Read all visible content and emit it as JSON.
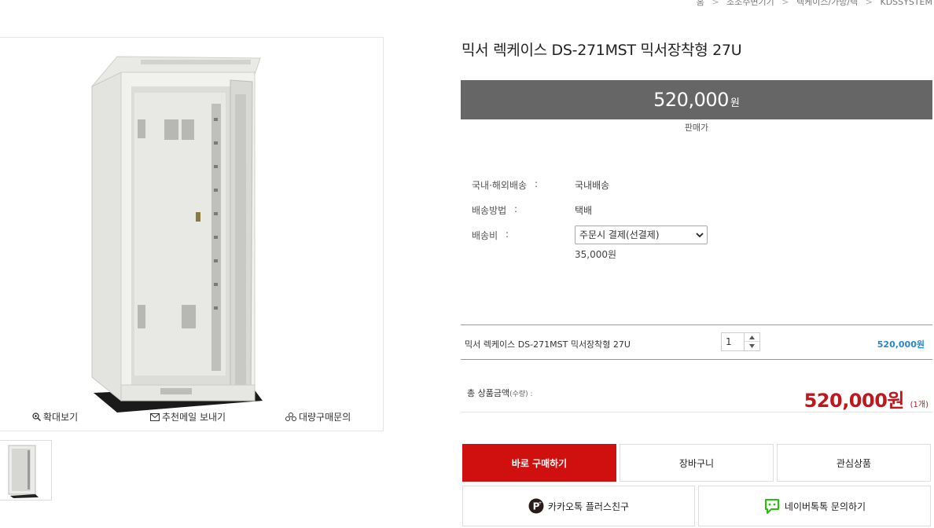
{
  "breadcrumb": {
    "home": "홈",
    "cat1": "조조주변기기",
    "cat2": "렉케이스/가방/렉",
    "cat3": "KDSSYSTEM",
    "sep": ">"
  },
  "product": {
    "title": "믹서 렉케이스 DS-271MST 믹서장착형 27U",
    "price_value": "520,000",
    "price_unit": "원",
    "price_caption": "판매가"
  },
  "image_actions": {
    "zoom": "확대보기",
    "email": "추천메일 보내기",
    "bulk": "대량구매문의"
  },
  "shipping": {
    "scope_label": "국내·해외배송",
    "scope_value": "국내배송",
    "method_label": "배송방법",
    "method_value": "택배",
    "fee_label": "배송비",
    "fee_select": "주문시 결제(선결제)",
    "fee_amount": "35,000원",
    "colon": ":"
  },
  "option": {
    "name": "믹서 렉케이스 DS-271MST 믹서장착형 27U",
    "qty": "1",
    "price": "520,000원"
  },
  "total": {
    "label": "총 상품금액",
    "label_sub": "(수량) :",
    "amount": "520,000원",
    "count": "(1개)"
  },
  "buttons": {
    "buy": "바로 구매하기",
    "cart": "장바구니",
    "wish": "관심상품",
    "kakao": "카카오톡 플러스친구",
    "naver": "네이버톡톡 문의하기"
  },
  "colors": {
    "accent_red": "#d0100f",
    "price_bar": "#666666",
    "option_price_blue": "#2a86c8",
    "naver_green": "#1ec800"
  },
  "icons": [
    "zoom-icon",
    "mail-icon",
    "group-icon",
    "kakao-plus-icon",
    "naver-talk-icon",
    "chevron-down-icon",
    "spinner-up-icon",
    "spinner-down-icon"
  ]
}
